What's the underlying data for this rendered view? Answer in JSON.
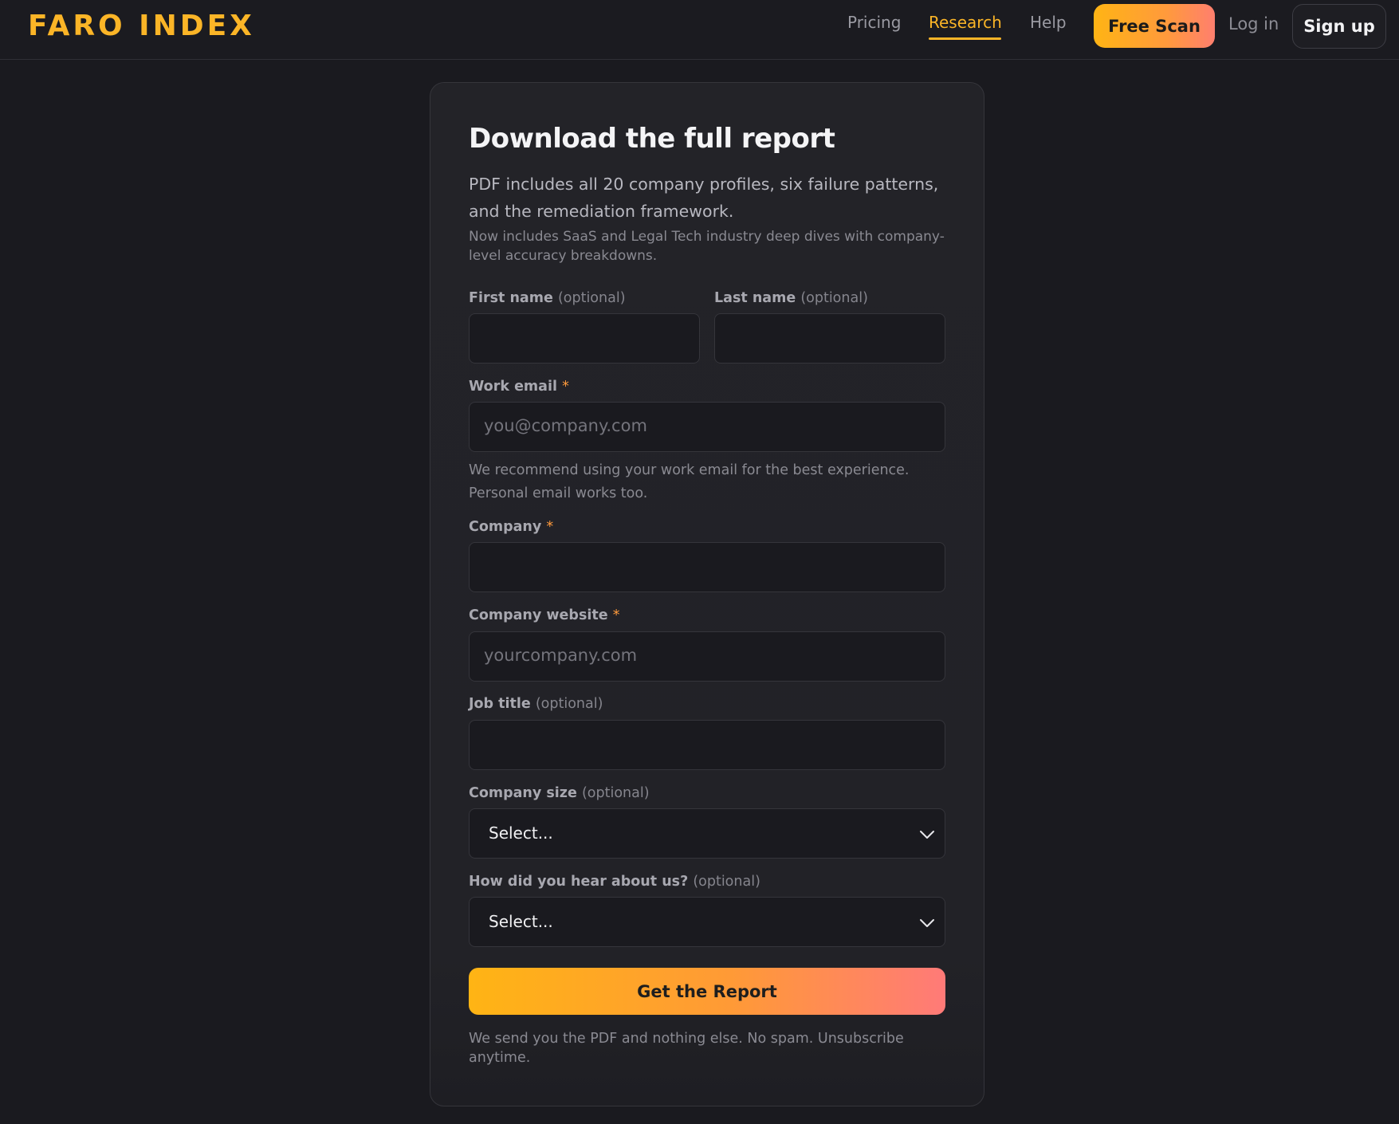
{
  "header": {
    "logo": "FARO INDEX",
    "nav": [
      {
        "label": "Pricing",
        "active": false
      },
      {
        "label": "Research",
        "active": true
      },
      {
        "label": "Help",
        "active": false
      }
    ],
    "free_scan": "Free Scan",
    "login": "Log in",
    "signup": "Sign up"
  },
  "form": {
    "title": "Download the full report",
    "lede": "PDF includes all 20 company profiles, six failure patterns, and the remediation framework.",
    "note": "Now includes SaaS and Legal Tech industry deep dives with company-level accuracy breakdowns.",
    "first_name": {
      "label": "First name",
      "suffix": "(optional)",
      "value": ""
    },
    "last_name": {
      "label": "Last name",
      "suffix": "(optional)",
      "value": ""
    },
    "work_email": {
      "label": "Work email",
      "required_mark": "*",
      "placeholder": "you@company.com",
      "value": ""
    },
    "email_helper": "We recommend using your work email for the best experience. Personal email works too.",
    "company": {
      "label": "Company",
      "required_mark": "*",
      "value": ""
    },
    "company_website": {
      "label": "Company website",
      "required_mark": "*",
      "placeholder": "yourcompany.com",
      "value": ""
    },
    "job_title": {
      "label": "Job title",
      "suffix": "(optional)",
      "value": ""
    },
    "company_size": {
      "label": "Company size",
      "suffix": "(optional)",
      "selected": "Select..."
    },
    "referral": {
      "label": "How did you hear about us?",
      "suffix": "(optional)",
      "selected": "Select..."
    },
    "submit": "Get the Report",
    "footnote": "We send you the PDF and nothing else. No spam. Unsubscribe anytime."
  },
  "colors": {
    "accent": "#fbb527",
    "gradient_start": "#ffb414",
    "gradient_end": "#ff7a78",
    "background": "#1a1a1f",
    "card": "#232328"
  }
}
